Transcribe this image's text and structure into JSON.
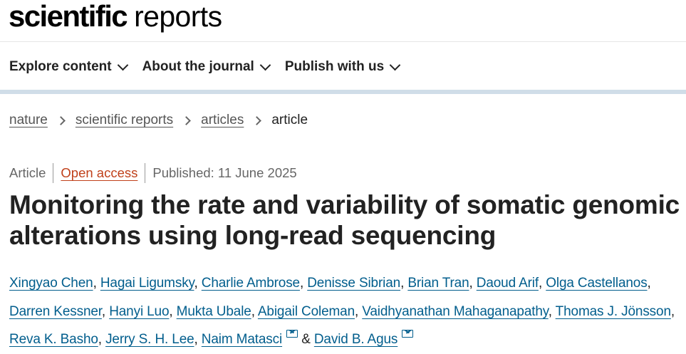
{
  "site": {
    "logo_bold": "scientific",
    "logo_light": "reports"
  },
  "nav": {
    "items": [
      {
        "label": "Explore content",
        "icon": "chevron-down-icon"
      },
      {
        "label": "About the journal",
        "icon": "chevron-down-icon"
      },
      {
        "label": "Publish with us",
        "icon": "chevron-down-icon"
      }
    ]
  },
  "breadcrumb": {
    "items": [
      {
        "label": "nature"
      },
      {
        "label": "scientific reports"
      },
      {
        "label": "articles"
      }
    ],
    "current": "article",
    "separator_icon": "chevron-right-icon"
  },
  "meta": {
    "type": "Article",
    "access": "Open access",
    "published": "Published: 11 June 2025"
  },
  "article": {
    "title": "Monitoring the rate and variability of somatic genomic alterations using long-read sequencing"
  },
  "authors": {
    "list": [
      "Xingyao Chen",
      "Hagai Ligumsky",
      "Charlie Ambrose",
      "Denisse Sibrian",
      "Brian Tran",
      "Daoud Arif",
      "Olga Castellanos",
      "Darren Kessner",
      "Hanyi Luo",
      "Mukta Ubale",
      "Abigail Coleman",
      "Vaidhyanathan Mahaganapathy",
      "Thomas J. Jönsson",
      "Reva K. Basho",
      "Jerry S. H. Lee",
      "Naim Matasci",
      "David B. Agus"
    ],
    "separator": ", ",
    "ampersand": " & ",
    "email_icon": "mail-icon"
  },
  "colors": {
    "link": "#025e8d",
    "open_access": "#c0411b",
    "nav_border": "#d0dde8"
  }
}
